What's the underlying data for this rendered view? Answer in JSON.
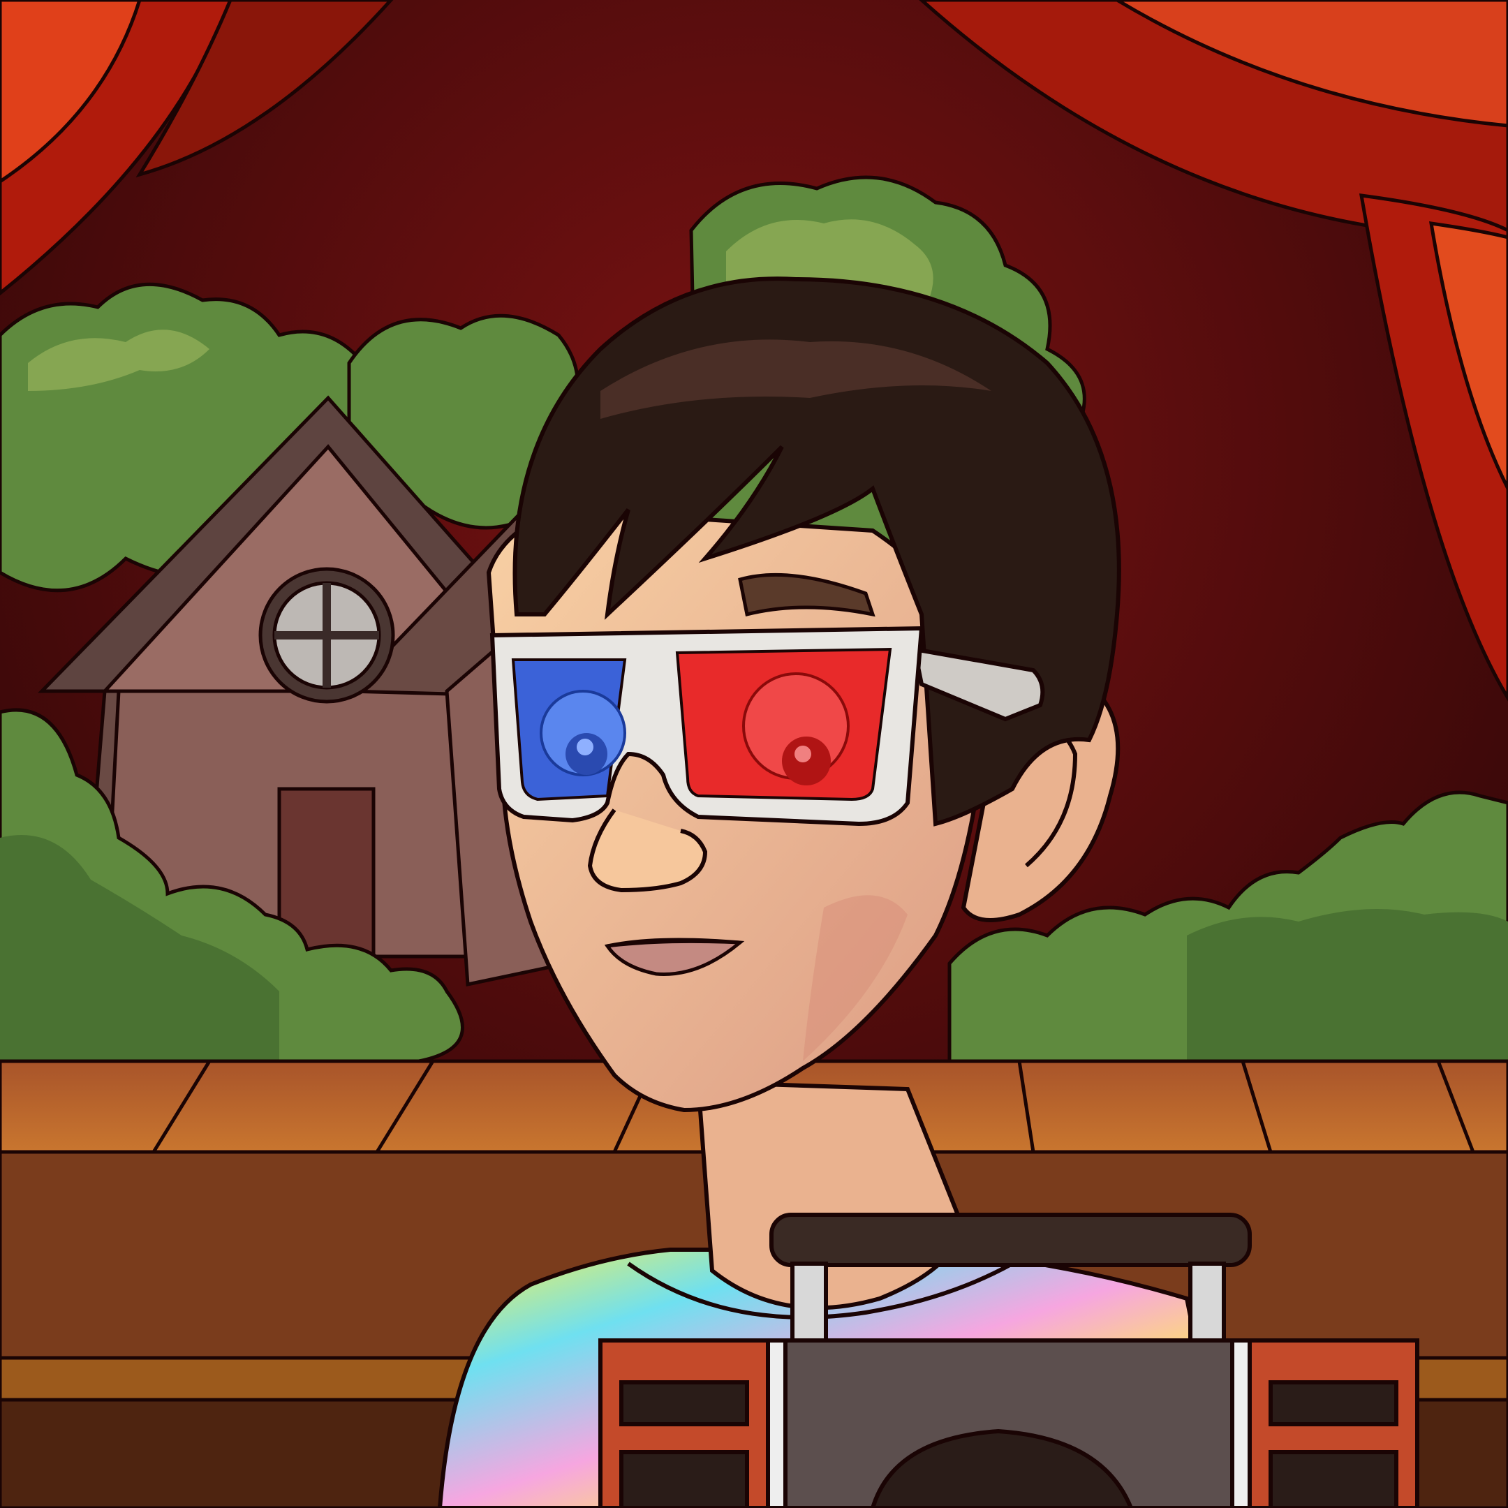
{
  "scene": {
    "subject": "cartoon-avatar",
    "colors": {
      "backdrop_dark": "#2c0607",
      "backdrop_glow": "#7a1212",
      "curtain_main": "#b01b0c",
      "curtain_light": "#e0401a",
      "curtain_dark": "#6e1208",
      "foliage": "#5f8a3e",
      "foliage_light": "#86a652",
      "house_wall": "#8a5f58",
      "house_roof": "#5e4440",
      "stage_floor": "#b8622a",
      "stage_front": "#7a3c1c",
      "skin": "#f2c49a",
      "skin_shade": "#d89a82",
      "hair": "#2a1a14",
      "glasses_frame": "#e8e6e2",
      "lens_left": "#3b62d8",
      "lens_right": "#e82a2a",
      "boombox_body": "#5c4f4e",
      "boombox_accent": "#c44a2a"
    },
    "icons": [
      "house-icon",
      "window-icon",
      "tree-icon",
      "glasses-icon",
      "boombox-icon"
    ]
  }
}
